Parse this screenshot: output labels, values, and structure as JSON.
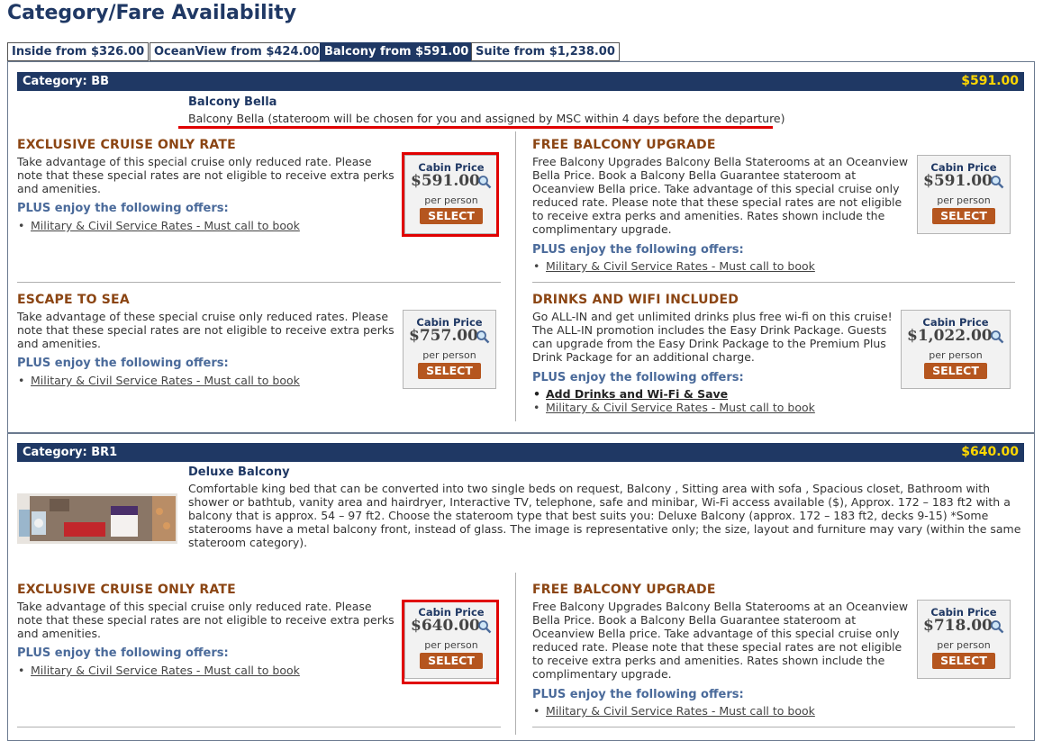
{
  "page": {
    "title": "Category/Fare Availability"
  },
  "tabs": [
    {
      "label": "Inside from $326.00"
    },
    {
      "label": "OceanView from $424.00"
    },
    {
      "label": "Balcony from $591.00"
    },
    {
      "label": "Suite from $1,238.00"
    }
  ],
  "common": {
    "cabin_price_label": "Cabin Price",
    "per_person": "per person",
    "select_label": "SELECT",
    "plus_text": "PLUS enjoy the following offers:",
    "military_link": "Military & Civil Service Rates - Must call to book"
  },
  "categories": [
    {
      "label": "Category: BB",
      "price": "$591.00",
      "room_title": "Balcony Bella",
      "room_desc": "Balcony Bella (stateroom will be chosen for you and assigned by MSC within 4 days before the departure)",
      "offers": [
        {
          "title": "EXCLUSIVE CRUISE ONLY RATE",
          "text": "Take advantage of this special cruise only reduced rate. Please note that these special rates are not eligible to receive extra perks and amenities.",
          "price": "$591.00"
        },
        {
          "title": "FREE BALCONY UPGRADE",
          "text": "Free Balcony Upgrades Balcony Bella Staterooms at an Oceanview Bella Price. Book a Balcony Bella Guarantee stateroom at Oceanview Bella price. Take advantage of this special cruise only reduced rate. Please note that these special rates are not eligible to receive extra perks and amenities. Rates shown include the complimentary upgrade.",
          "price": "$591.00"
        },
        {
          "title": "ESCAPE TO SEA",
          "text": "Take advantage of these special cruise only reduced rates. Please note that these special rates are not eligible to receive extra perks and amenities.",
          "price": "$757.00"
        },
        {
          "title": "DRINKS AND WIFI INCLUDED",
          "text": "Go ALL-IN and get unlimited drinks plus free wi-fi on this cruise! The ALL-IN promotion includes the Easy Drink Package. Guests can upgrade from the Easy Drink Package to the Premium Plus Drink Package for an additional charge.",
          "price": "$1,022.00",
          "extra_link": "Add Drinks and Wi-Fi & Save"
        }
      ]
    },
    {
      "label": "Category: BR1",
      "price": "$640.00",
      "room_title": "Deluxe Balcony",
      "room_desc": "Comfortable king bed that can be converted into two single beds on request, Balcony , Sitting area with sofa , Spacious closet, Bathroom with shower or bathtub, vanity area and hairdryer, Interactive TV, telephone, safe and minibar, Wi-Fi access available ($), Approx. 172 – 183 ft2 with a balcony that is approx. 54 – 97 ft2. Choose the stateroom type that best suits you: Deluxe Balcony (approx. 172 – 183 ft2, decks 9-15) *Some staterooms have a metal balcony front, instead of glass. The image is representative only; the size, layout and furniture may vary (within the same stateroom category).",
      "offers": [
        {
          "title": "EXCLUSIVE CRUISE ONLY RATE",
          "text": "Take advantage of this special cruise only reduced rate. Please note that these special rates are not eligible to receive extra perks and amenities.",
          "price": "$640.00"
        },
        {
          "title": "FREE BALCONY UPGRADE",
          "text": "Free Balcony Upgrades Balcony Bella Staterooms at an Oceanview Bella Price. Book a Balcony Bella Guarantee stateroom at Oceanview Bella price. Take advantage of this special cruise only reduced rate. Please note that these special rates are not eligible to receive extra perks and amenities. Rates shown include the complimentary upgrade.",
          "price": "$718.00"
        }
      ]
    }
  ],
  "colors": {
    "navy": "#1f3864",
    "gold": "#ffd700",
    "offer_brown": "#8b4513",
    "select_orange": "#b5561f",
    "highlight_red": "#e00000"
  },
  "icons": {
    "magnifier": "magnifier-icon",
    "cabin_image": "cabin-layout-image"
  }
}
